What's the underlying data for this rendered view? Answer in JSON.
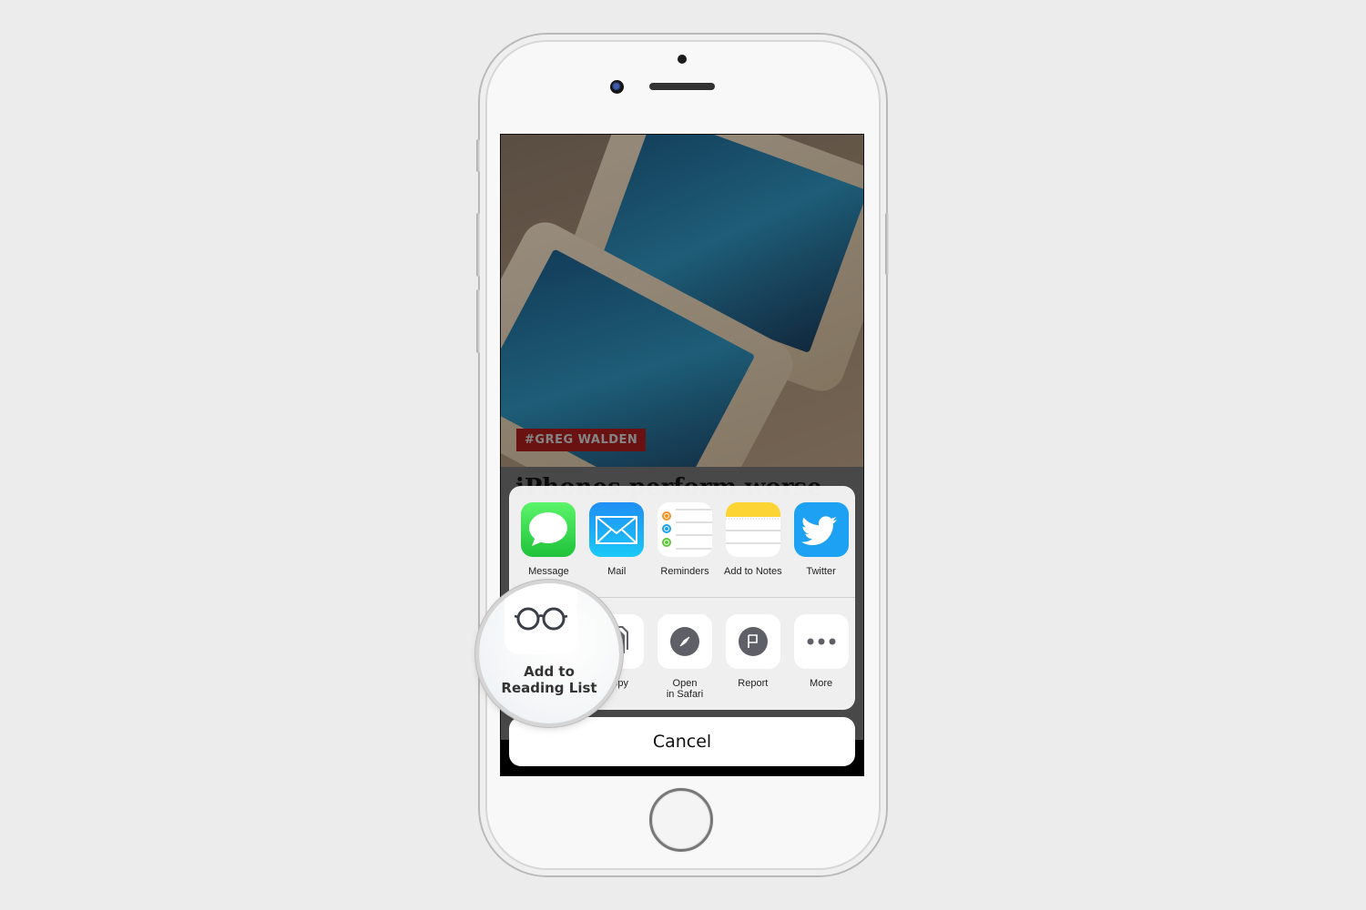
{
  "device": {
    "type": "iPhone",
    "color_body": "#f8f8f8",
    "color_background": "#ececec"
  },
  "article": {
    "tag": "#GREG WALDEN",
    "tag_color": "#a31d1d",
    "title": "iPhones perform worse"
  },
  "share_sheet": {
    "apps": [
      {
        "label": "Message",
        "icon": "message-icon"
      },
      {
        "label": "Mail",
        "icon": "mail-icon"
      },
      {
        "label": "Reminders",
        "icon": "reminders-icon"
      },
      {
        "label": "Add to Notes",
        "icon": "notes-icon"
      },
      {
        "label": "Twitter",
        "icon": "twitter-icon"
      }
    ],
    "actions": [
      {
        "label": "Add to Reading List",
        "icon": "reading-glasses-icon"
      },
      {
        "label": "Copy",
        "icon": "copy-icon"
      },
      {
        "label_line1": "Open",
        "label_line2": "in Safari",
        "icon": "compass-icon"
      },
      {
        "label": "Report",
        "icon": "flag-icon"
      },
      {
        "label": "More",
        "icon": "more-icon"
      }
    ],
    "cancel_label": "Cancel"
  },
  "magnifier": {
    "line1": "Add to",
    "line2": "Reading List"
  }
}
